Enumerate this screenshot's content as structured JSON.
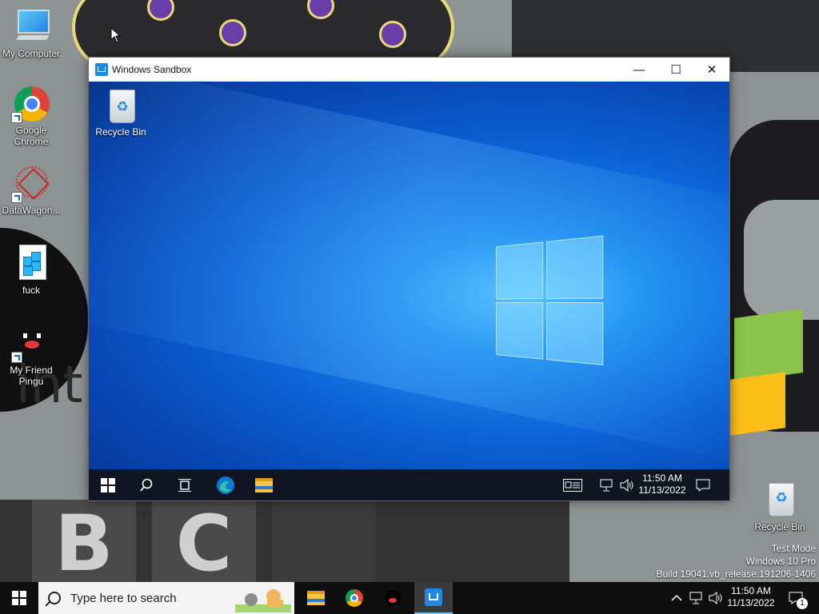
{
  "desktop_icons": [
    {
      "label_lines": [
        "My Computer"
      ],
      "icon": "computer-icon"
    },
    {
      "label_lines": [
        "Google",
        "Chrome"
      ],
      "icon": "chrome-icon"
    },
    {
      "label_lines": [
        "DataWagon..."
      ],
      "icon": "datawagon-icon"
    },
    {
      "label_lines": [
        "fuck"
      ],
      "icon": "registry-file-icon"
    },
    {
      "label_lines": [
        "My Friend",
        "Pingu"
      ],
      "icon": "pingu-icon"
    }
  ],
  "host_recycle_bin": {
    "label": "Recycle Bin",
    "icon": "recycle-bin-icon"
  },
  "sandbox_window": {
    "title": "Windows Sandbox",
    "caption_buttons": {
      "minimize": "—",
      "maximize": "☐",
      "close": "✕"
    },
    "desktop": {
      "recycle_bin_label": "Recycle Bin"
    },
    "taskbar": {
      "items": [
        "start-icon",
        "search-icon",
        "task-view-icon",
        "edge-icon",
        "file-explorer-icon"
      ],
      "tray": {
        "time": "11:50 AM",
        "date": "11/13/2022"
      }
    }
  },
  "watermark": {
    "line1": "Test Mode",
    "line2": "Windows 10 Pro",
    "line3": "Build 19041.vb_release.191206-1406"
  },
  "taskbar": {
    "search_placeholder": "Type here to search",
    "pinned": [
      "file-explorer-icon",
      "chrome-icon",
      "pingu-icon",
      "windows-sandbox-icon"
    ],
    "active": "windows-sandbox-icon",
    "tray": {
      "time": "11:50 AM",
      "date": "11/13/2022",
      "notification_count": "1"
    }
  },
  "colors": {
    "sandbox_accent": "#1e88e5",
    "taskbar_bg": "#0f0f10",
    "sandbox_taskbar_bg": "#101621"
  }
}
